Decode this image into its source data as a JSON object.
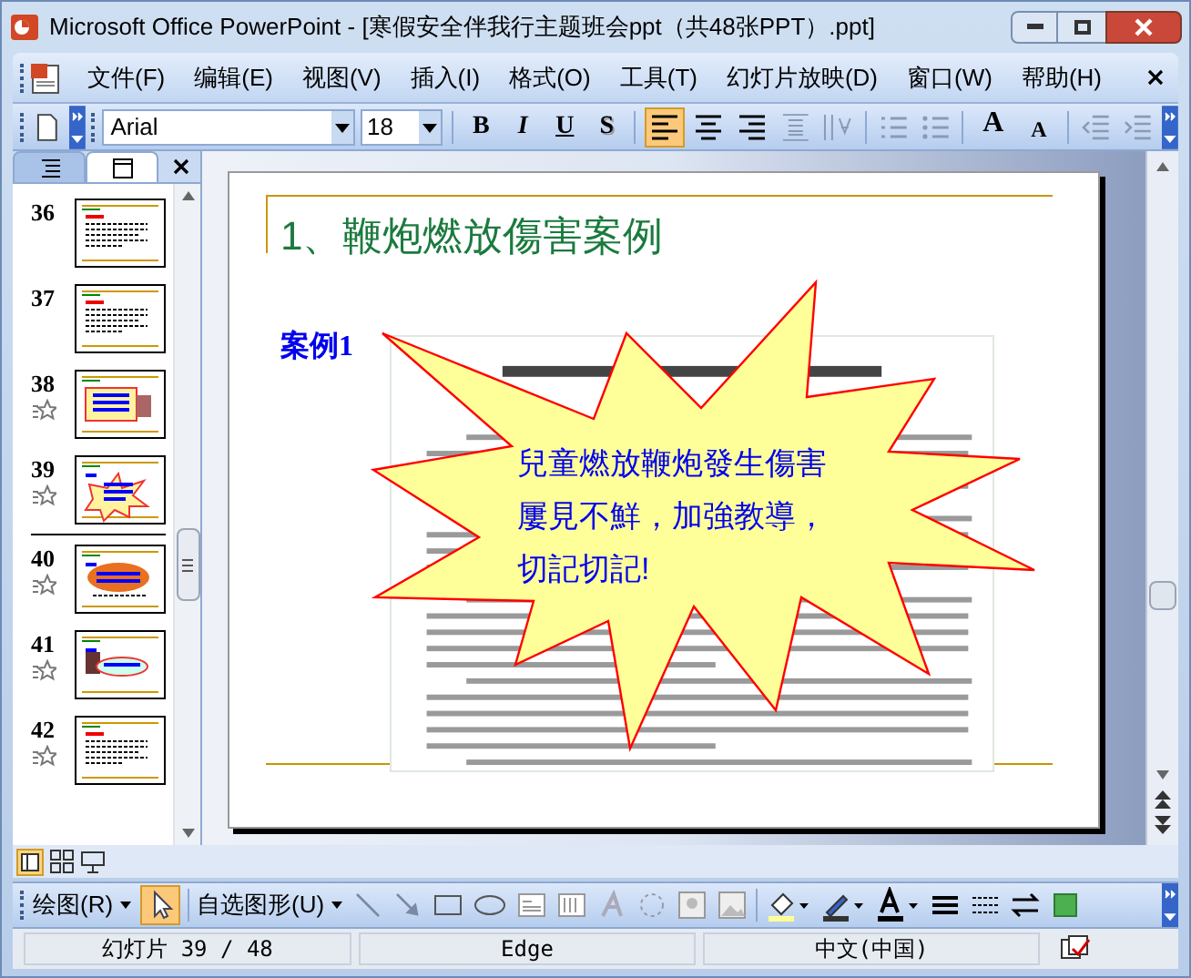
{
  "window": {
    "title": "Microsoft Office PowerPoint - [寒假安全伴我行主题班会ppt（共48张PPT）.ppt]"
  },
  "menu": [
    "文件(F)",
    "编辑(E)",
    "视图(V)",
    "插入(I)",
    "格式(O)",
    "工具(T)",
    "幻灯片放映(D)",
    "窗口(W)",
    "帮助(H)"
  ],
  "format_toolbar": {
    "font": "Arial",
    "size": "18",
    "style_buttons": [
      {
        "label": "B",
        "kind": "bold"
      },
      {
        "label": "I",
        "kind": "italic"
      },
      {
        "label": "U",
        "kind": "underline"
      },
      {
        "label": "S",
        "kind": "shadow"
      }
    ],
    "align": [
      {
        "kind": "left",
        "selected": true
      },
      {
        "kind": "center",
        "selected": false
      },
      {
        "kind": "right",
        "selected": false
      }
    ],
    "size_buttons": [
      {
        "label": "A",
        "kind": "grow"
      },
      {
        "label": "A",
        "kind": "shrink"
      }
    ]
  },
  "slides_pane": {
    "tabs": [
      {
        "kind": "outline",
        "selected": false
      },
      {
        "kind": "slides",
        "selected": true
      }
    ],
    "thumbnails": [
      {
        "number": "36",
        "animated": false,
        "kind": "text"
      },
      {
        "number": "37",
        "animated": false,
        "kind": "text"
      },
      {
        "number": "38",
        "animated": true,
        "kind": "banner"
      },
      {
        "number": "39",
        "animated": true,
        "kind": "burst"
      },
      {
        "number": "40",
        "animated": true,
        "kind": "cloud"
      },
      {
        "number": "41",
        "animated": true,
        "kind": "oval"
      },
      {
        "number": "42",
        "animated": true,
        "kind": "text"
      }
    ]
  },
  "slide": {
    "title": "1、鞭炮燃放傷害案例",
    "label": "案例1",
    "callout": [
      "兒童燃放鞭炮發生傷害",
      "屢見不鮮，加強教導，",
      "切記切記!"
    ]
  },
  "drawing_toolbar": {
    "draw_menu": "绘图(R)",
    "autoshapes": "自选图形(U)"
  },
  "status_bar": [
    "幻灯片 39 / 48",
    "Edge",
    "中文(中国)"
  ]
}
